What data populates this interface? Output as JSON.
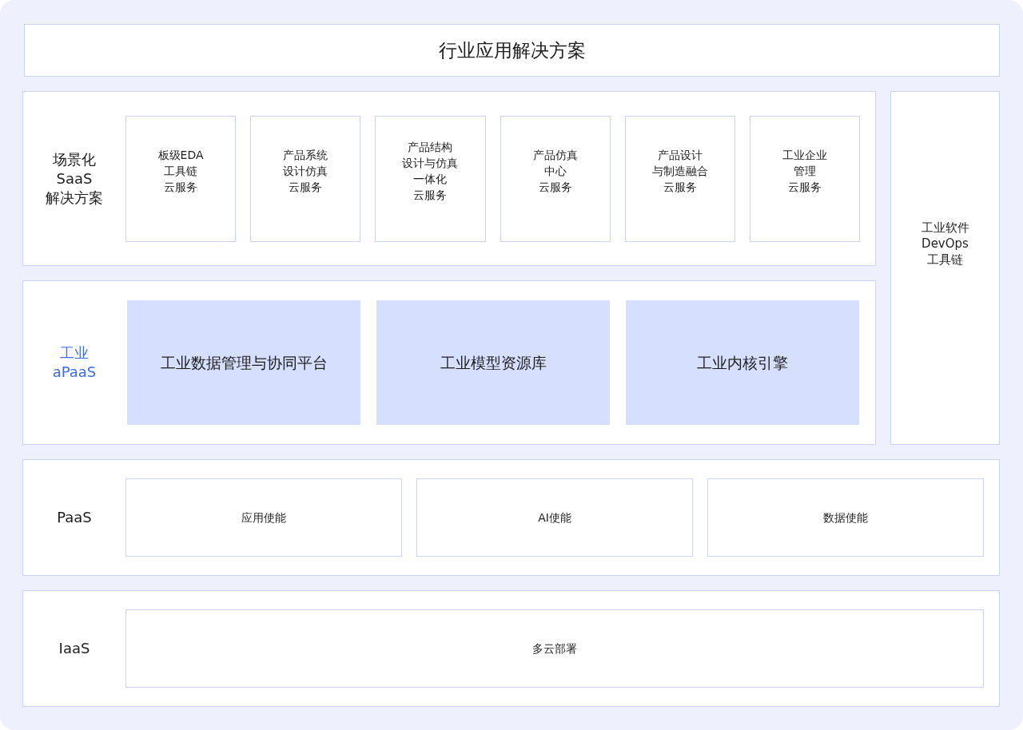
{
  "header": {
    "title": "行业应用解决方案"
  },
  "saas": {
    "label": "场景化\nSaaS\n解决方案",
    "items": [
      {
        "lines": [
          "板级EDA",
          "工具链",
          "云服务"
        ]
      },
      {
        "lines": [
          "产品系统",
          "设计仿真",
          "云服务"
        ]
      },
      {
        "lines": [
          "产品结构",
          "设计与仿真",
          "一体化",
          "云服务"
        ]
      },
      {
        "lines": [
          "产品仿真",
          "中心",
          "云服务"
        ]
      },
      {
        "lines": [
          "产品设计",
          "与制造融合",
          "云服务"
        ]
      },
      {
        "lines": [
          "工业企业",
          "管理",
          "云服务"
        ]
      }
    ]
  },
  "apaas": {
    "label": "工业\naPaaS",
    "items": [
      "工业数据管理与协同平台",
      "工业模型资源库",
      "工业内核引擎"
    ]
  },
  "side": {
    "label": "工业软件\nDevOps\n工具链"
  },
  "paas": {
    "label": "PaaS",
    "items": [
      "应用使能",
      "AI使能",
      "数据使能"
    ]
  },
  "iaas": {
    "label": "IaaS",
    "items": [
      "多云部署"
    ]
  }
}
